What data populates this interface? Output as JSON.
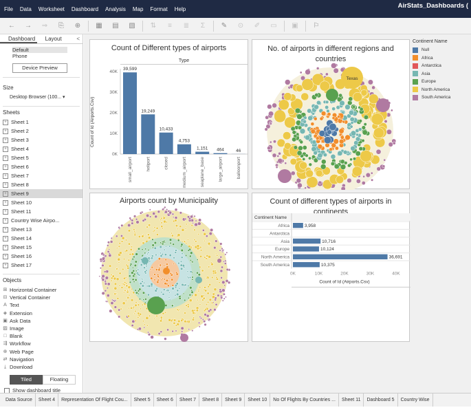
{
  "menubar": {
    "items": [
      "File",
      "Data",
      "Worksheet",
      "Dashboard",
      "Analysis",
      "Map",
      "Format",
      "Help"
    ],
    "window_title": "AirStats_Dashboards ("
  },
  "toolbar": {
    "icons": [
      "back-arrow-icon",
      "forward-arrow-icon",
      "save-icon",
      "add-datasource-icon",
      "new-worksheet-icon",
      "duplicate-icon",
      "clear-icon",
      "swap-icon",
      "sort-asc-icon",
      "sort-desc-icon",
      "totals-icon",
      "highlight-icon",
      "group-icon",
      "label-icon",
      "fix-axes-icon",
      "fit-icon",
      "show-cards-icon",
      "presentation-icon"
    ]
  },
  "left_panel": {
    "tabs": [
      "Dashboard",
      "Layout"
    ],
    "collapse": "<",
    "device_options": [
      "Default",
      "Phone"
    ],
    "device_preview": "Device Preview",
    "size_heading": "Size",
    "size_value": "Desktop Browser (100...",
    "sheets_heading": "Sheets",
    "sheets": [
      "Sheet 1",
      "Sheet 2",
      "Sheet 3",
      "Sheet 4",
      "Sheet 5",
      "Sheet 6",
      "Sheet 7",
      "Sheet 8",
      "Sheet 9",
      "Sheet 10",
      "Sheet 11",
      "Country Wise Airpo...",
      "Sheet 13",
      "Sheet 14",
      "Sheet 15",
      "Sheet 16",
      "Sheet 17"
    ],
    "selected_sheet": "Sheet 9",
    "objects_heading": "Objects",
    "objects": [
      {
        "label": "Horizontal Container",
        "icon": "horizontal-container-icon",
        "glyph": "⊞"
      },
      {
        "label": "Vertical Container",
        "icon": "vertical-container-icon",
        "glyph": "⊟"
      },
      {
        "label": "Text",
        "icon": "text-icon",
        "glyph": "A"
      },
      {
        "label": "Extension",
        "icon": "extension-icon",
        "glyph": "◈"
      },
      {
        "label": "Ask Data",
        "icon": "ask-data-icon",
        "glyph": "▣"
      },
      {
        "label": "Image",
        "icon": "image-icon",
        "glyph": "▨"
      },
      {
        "label": "Blank",
        "icon": "blank-icon",
        "glyph": "□"
      },
      {
        "label": "Workflow",
        "icon": "workflow-icon",
        "glyph": "⇶"
      },
      {
        "label": "Web Page",
        "icon": "web-page-icon",
        "glyph": "⊕"
      },
      {
        "label": "Navigation",
        "icon": "navigation-icon",
        "glyph": "⇄"
      },
      {
        "label": "Download",
        "icon": "download-icon",
        "glyph": "⤓"
      }
    ],
    "tiled": "Tiled",
    "floating": "Floating",
    "show_title": "Show dashboard title"
  },
  "zones": {
    "bar_title": "Count of Different types of airports",
    "bubble_title": "No. of airports in different regions and countries",
    "bubble_label": "Texas",
    "muni_title": "Airports count by Municipality",
    "cont_title": "Count of different types of airports in continents"
  },
  "legend": {
    "title": "Continent Name",
    "items": [
      {
        "label": "Null",
        "color": "#4e79a7"
      },
      {
        "label": "Africa",
        "color": "#f28e2b"
      },
      {
        "label": "Antarctica",
        "color": "#e15759"
      },
      {
        "label": "Asia",
        "color": "#76b7b2"
      },
      {
        "label": "Europe",
        "color": "#59a14f"
      },
      {
        "label": "North America",
        "color": "#edc948"
      },
      {
        "label": "South America",
        "color": "#b07aa1"
      }
    ]
  },
  "chart_data": [
    {
      "type": "bar",
      "title": "Count of Different types of airports",
      "header": "Type",
      "ylabel": "Count of Id (Airports.Csv)",
      "yticks": [
        "40K",
        "30K",
        "20K",
        "10K",
        "0K"
      ],
      "ylim": [
        0,
        40000
      ],
      "categories": [
        "small_airport",
        "heliport",
        "closed",
        "medium_airport",
        "seaplane_base",
        "large_airport",
        "balloonport"
      ],
      "values": [
        39599,
        19249,
        10433,
        4753,
        1151,
        464,
        46
      ],
      "labels": [
        "39,599",
        "19,249",
        "10,433",
        "4,753",
        "1,151",
        "464",
        "46"
      ],
      "color": "#4e79a7"
    },
    {
      "type": "bar",
      "orientation": "horizontal",
      "title": "Count of different types of airports in continents",
      "row_header": "Continent Name",
      "xlabel": "Count of Id (Airports.Csv)",
      "xticks": [
        "0K",
        "10K",
        "20K",
        "30K",
        "40K"
      ],
      "xlim": [
        0,
        40000
      ],
      "categories": [
        "Africa",
        "Antarctica",
        "Asia",
        "Europe",
        "North America",
        "South America"
      ],
      "values": [
        3958,
        null,
        10716,
        10124,
        36691,
        10375
      ],
      "labels": [
        "3,958",
        "",
        "10,716",
        "10,124",
        "36,691",
        "10,375"
      ],
      "color": "#4e79a7"
    }
  ],
  "bottom_tabs": [
    "Data Source",
    "Sheet 4",
    "Representation Of Flight Cou...",
    "Sheet 5",
    "Sheet 6",
    "Sheet 7",
    "Sheet 8",
    "Sheet 9",
    "Sheet 10",
    "No Of Flights By Countries ...",
    "Sheet 11",
    "Dashboard 5",
    "Country Wise"
  ]
}
